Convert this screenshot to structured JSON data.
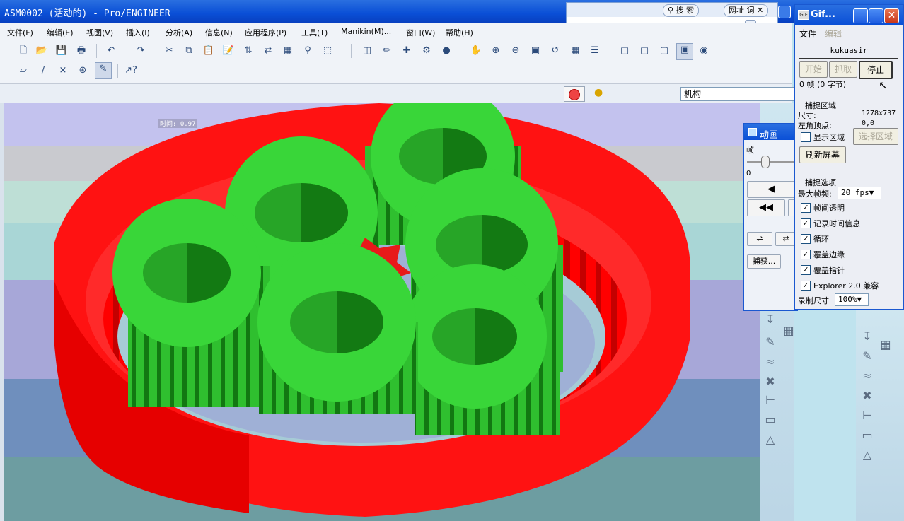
{
  "window": {
    "title": "ASM0002 (活动的) - Pro/ENGINEER"
  },
  "search_popup": {
    "search_label": "搜 索",
    "url_label": "网址 词"
  },
  "menu": [
    "文件(F)",
    "编辑(E)",
    "视图(V)",
    "插入(I)",
    "分析(A)",
    "信息(N)",
    "应用程序(P)",
    "工具(T)",
    "Manikin(M)...",
    "窗口(W)",
    "帮助(H)"
  ],
  "statusbar": {
    "mechanism_value": "机构"
  },
  "viewport": {
    "overlay_text": "时间: 0.97"
  },
  "animation_panel": {
    "title": "动画",
    "frame_label": "帧",
    "frame_value": "0",
    "capture_label": "捕获..."
  },
  "gif_tool": {
    "title": "Gif...",
    "menu": {
      "file": "文件",
      "edit": "编辑"
    },
    "user": "kukuasir",
    "buttons": {
      "start": "开始",
      "grab": "抓取",
      "stop": "停止"
    },
    "frame_info": "0 帧 (0 字节)",
    "capture_area": {
      "heading": "捕捉区域",
      "size_label": "尺寸:",
      "size_value": "1278x737",
      "origin_label": "左角顶点:",
      "origin_value": "0,0",
      "show_area_label": "显示区域",
      "show_area_checked": false,
      "select_area_button": "选择区域",
      "refresh_button": "刷新屏幕"
    },
    "capture_options": {
      "heading": "捕捉选项",
      "max_fps_label": "最大帧频:",
      "max_fps_value": "20 fps",
      "options": [
        {
          "label": "帧间透明",
          "checked": true
        },
        {
          "label": "记录时间信息",
          "checked": true
        },
        {
          "label": "循环",
          "checked": true
        },
        {
          "label": "覆盖边缘",
          "checked": true
        },
        {
          "label": "覆盖指针",
          "checked": true
        },
        {
          "label": "Explorer 2.0 兼容",
          "checked": true
        }
      ],
      "record_size_label": "录制尺寸",
      "record_size_value": "100%"
    }
  },
  "colors": {
    "ring_gear": "#ff0000",
    "planet_gears": "#2ecc2e",
    "sun_gear": "#e8191a",
    "title_bar": "#0a4fd6"
  }
}
